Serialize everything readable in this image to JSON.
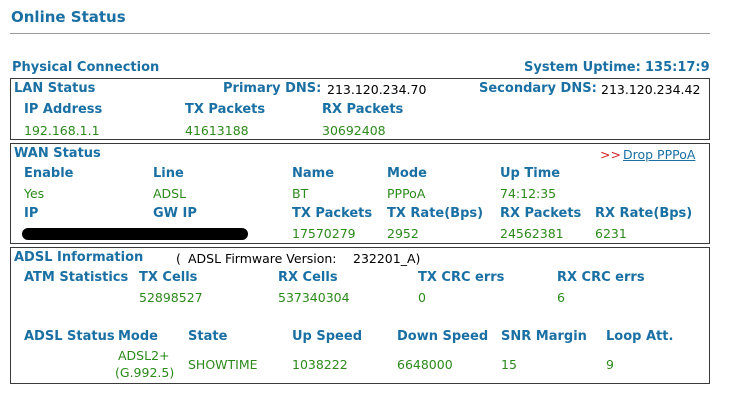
{
  "page": {
    "title": "Online Status"
  },
  "physical": {
    "label": "Physical Connection",
    "uptime_label": "System Uptime:",
    "uptime": "135:17:9"
  },
  "lan": {
    "title": "LAN Status",
    "primary_dns_label": "Primary DNS:",
    "primary_dns": "213.120.234.70",
    "secondary_dns_label": "Secondary DNS:",
    "secondary_dns": "213.120.234.42",
    "headers": {
      "ip": "IP Address",
      "tx": "TX Packets",
      "rx": "RX Packets"
    },
    "values": {
      "ip": "192.168.1.1",
      "tx": "41613188",
      "rx": "30692408"
    }
  },
  "wan": {
    "title": "WAN Status",
    "drop_prefix": ">>",
    "drop_link": "Drop PPPoA",
    "headers1": {
      "enable": "Enable",
      "line": "Line",
      "name": "Name",
      "mode": "Mode",
      "uptime": "Up Time"
    },
    "values1": {
      "enable": "Yes",
      "line": "ADSL",
      "name": "BT",
      "mode": "PPPoA",
      "uptime": "74:12:35"
    },
    "headers2": {
      "ip": "IP",
      "gw": "GW IP",
      "tx_packets": "TX Packets",
      "tx_rate": "TX Rate(Bps)",
      "rx_packets": "RX Packets",
      "rx_rate": "RX Rate(Bps)"
    },
    "values2": {
      "tx_packets": "17570279",
      "tx_rate": "2952",
      "rx_packets": "24562381",
      "rx_rate": "6231"
    }
  },
  "adsl": {
    "title": "ADSL Information",
    "firmware_open": "(",
    "firmware_label": "ADSL Firmware Version:",
    "firmware": "232201_A)",
    "atm_label": "ATM Statistics",
    "atm_headers": {
      "tx_cells": "TX Cells",
      "rx_cells": "RX Cells",
      "tx_crc": "TX CRC errs",
      "rx_crc": "RX CRC errs"
    },
    "atm_values": {
      "tx_cells": "52898527",
      "rx_cells": "537340304",
      "tx_crc": "0",
      "rx_crc": "6"
    },
    "status_headers": {
      "adsl_status": "ADSL Status",
      "mode": "Mode",
      "state": "State",
      "up": "Up Speed",
      "down": "Down Speed",
      "snr": "SNR Margin",
      "loop": "Loop Att."
    },
    "status_values": {
      "mode_line1": "ADSL2+",
      "mode_line2": "(G.992.5)",
      "state": "SHOWTIME",
      "up": "1038222",
      "down": "6648000",
      "snr": "15",
      "loop": "9"
    }
  }
}
